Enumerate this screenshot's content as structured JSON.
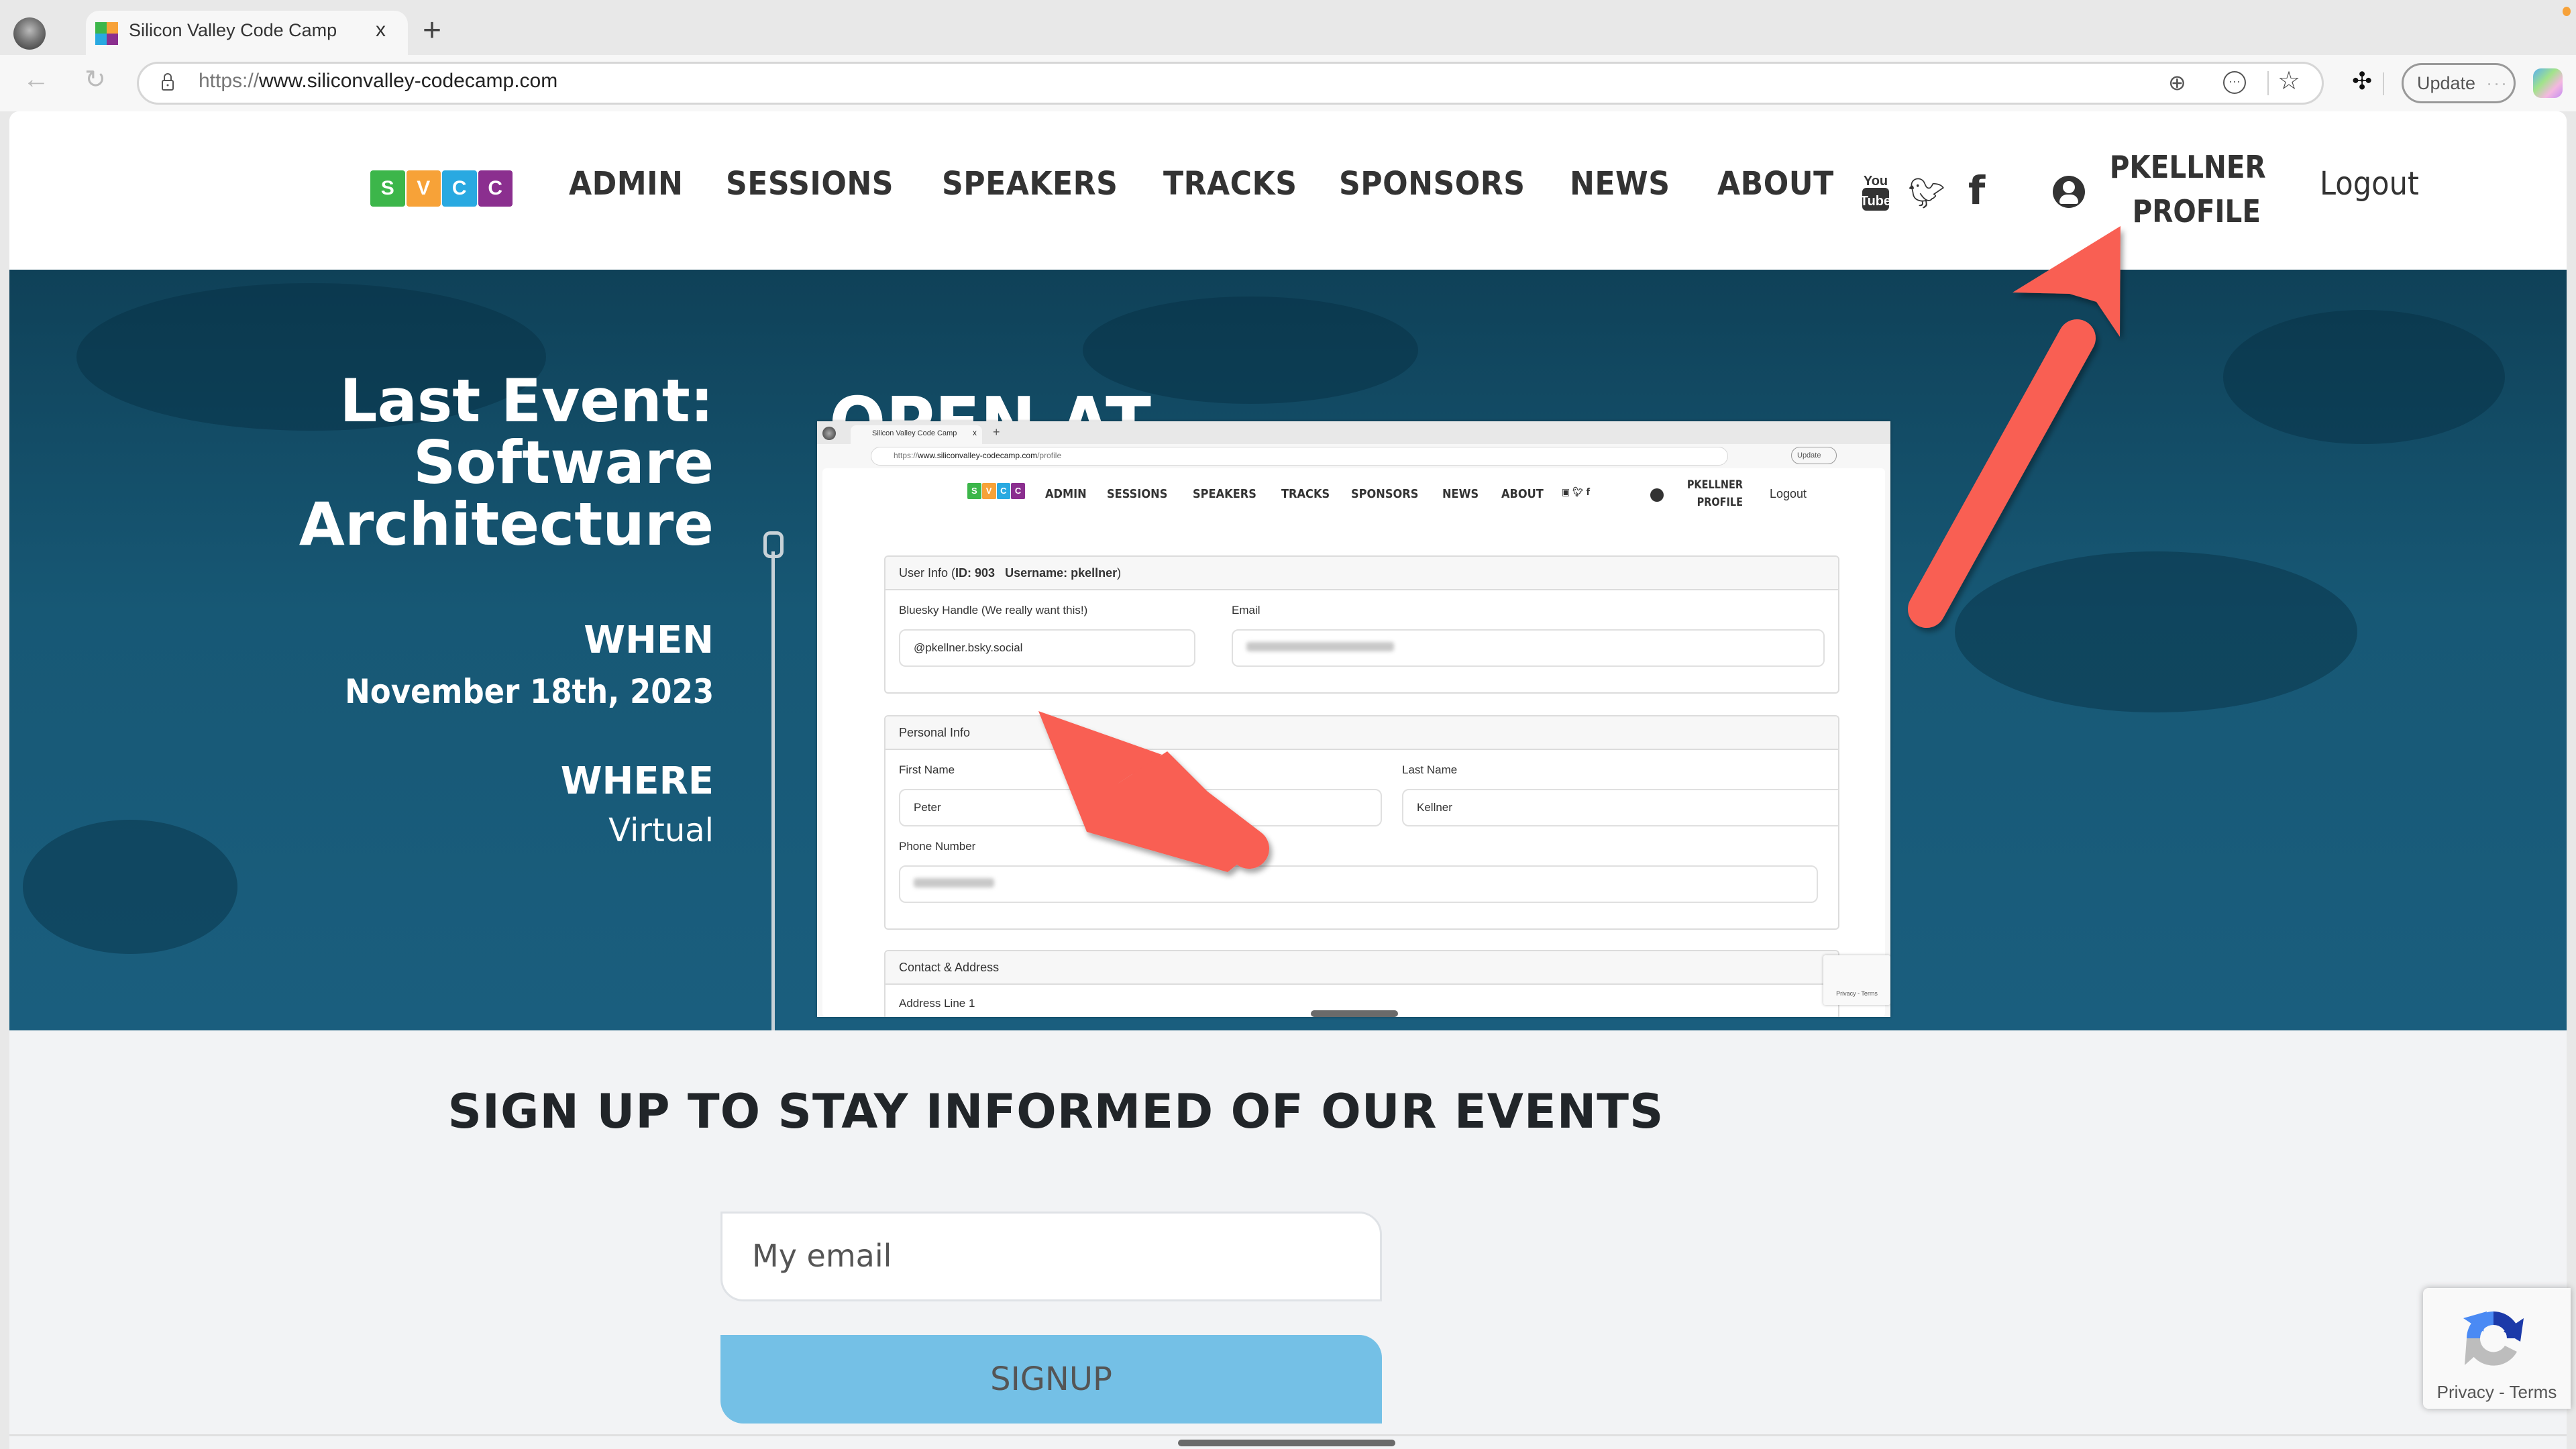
{
  "browser": {
    "tab_title": "Silicon Valley Code Camp",
    "tab_close": "x",
    "new_tab": "+",
    "url_scheme": "https://",
    "url_host": "www.siliconvalley-codecamp.com",
    "update_label": "Update",
    "update_dots": "···"
  },
  "nav": {
    "logo_letters": [
      "S",
      "V",
      "C",
      "C"
    ],
    "logo_colors": [
      "#3cb64a",
      "#f7a238",
      "#29a9e1",
      "#8b2f8f"
    ],
    "links": [
      "ADMIN",
      "SESSIONS",
      "SPEAKERS",
      "TRACKS",
      "SPONSORS",
      "NEWS",
      "ABOUT"
    ],
    "user_line1": "PKELLNER",
    "user_line2": "PROFILE",
    "logout": "Logout",
    "social_icons": [
      "youtube-icon",
      "twitter-icon",
      "facebook-icon"
    ]
  },
  "hero": {
    "event_line1": "Last Event:",
    "event_line2": "Software",
    "event_line3": "Architecture",
    "when_label": "WHEN",
    "when_value": "November 18th, 2023",
    "where_label": "WHERE",
    "where_value": "Virtual",
    "open_at": "OPEN AT"
  },
  "inner_screenshot": {
    "tab_title": "Silicon Valley Code Camp",
    "url_scheme": "https://",
    "url_host": "www.siliconvalley-codecamp.com",
    "url_path": "/profile",
    "update_label": "Update",
    "nav_links": [
      "ADMIN",
      "SESSIONS",
      "SPEAKERS",
      "TRACKS",
      "SPONSORS",
      "NEWS",
      "ABOUT"
    ],
    "user_line1": "PKELLNER",
    "user_line2": "PROFILE",
    "logout": "Logout",
    "user_info": {
      "header_prefix": "User Info (",
      "id_label": "ID: 903",
      "username_label": "Username: pkellner",
      "header_suffix": ")",
      "bluesky_label": "Bluesky Handle (We really want this!)",
      "bluesky_value": "@pkellner.bsky.social",
      "email_label": "Email"
    },
    "personal_info": {
      "header": "Personal Info",
      "first_name_label": "First Name",
      "first_name_value": "Peter",
      "last_name_label": "Last Name",
      "last_name_value": "Kellner",
      "phone_label": "Phone Number"
    },
    "contact": {
      "header": "Contact & Address",
      "address1_label": "Address Line 1"
    },
    "recaptcha_text": "Privacy - Terms"
  },
  "annotations": {
    "arrow_color": "#f95f53"
  },
  "signup": {
    "heading": "SIGN UP TO STAY INFORMED OF OUR EVENTS",
    "email_placeholder": "My email",
    "button_label": "SIGNUP",
    "button_color": "#74c0e6"
  },
  "recaptcha": {
    "text": "Privacy - Terms"
  }
}
